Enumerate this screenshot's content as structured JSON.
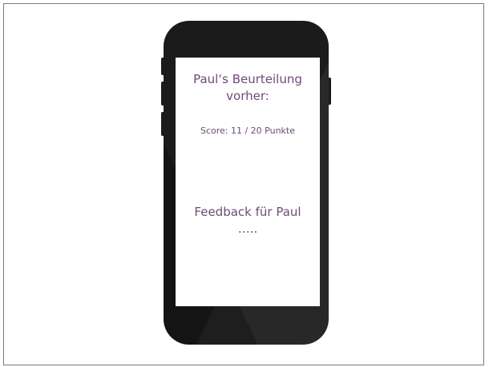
{
  "screen": {
    "title": "Paul‘s Beurteilung vorher:",
    "score": "Score: 11 / 20 Punkte",
    "feedback_heading": "Feedback für Paul",
    "feedback_placeholder": "….."
  },
  "colors": {
    "text": "#6e4a78",
    "phone_body": "#1b1b1b",
    "screen_bg": "#ffffff",
    "frame_border": "#7a7a7a"
  }
}
